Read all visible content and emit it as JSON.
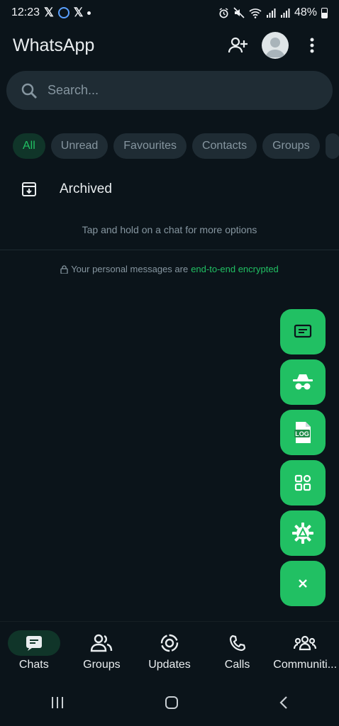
{
  "status_bar": {
    "time": "12:23",
    "battery": "48%"
  },
  "header": {
    "title": "WhatsApp"
  },
  "search": {
    "placeholder": "Search..."
  },
  "filters": [
    "All",
    "Unread",
    "Favourites",
    "Contacts",
    "Groups"
  ],
  "archived": {
    "label": "Archived"
  },
  "hint": "Tap and hold on a chat for more options",
  "encryption": {
    "prefix": "Your personal messages are",
    "link": "end-to-end encrypted"
  },
  "fab_menu": [
    "message-icon",
    "incognito-icon",
    "log-file-icon",
    "apps-grid-icon",
    "settings-gear-icon",
    "close-icon"
  ],
  "bottom_nav": [
    {
      "label": "Chats",
      "icon": "chats-icon"
    },
    {
      "label": "Groups",
      "icon": "groups-icon"
    },
    {
      "label": "Updates",
      "icon": "updates-icon"
    },
    {
      "label": "Calls",
      "icon": "calls-icon"
    },
    {
      "label": "Communiti...",
      "icon": "communities-icon"
    }
  ],
  "colors": {
    "background": "#0b141a",
    "accent": "#21c063",
    "surface": "#1f2c34"
  }
}
